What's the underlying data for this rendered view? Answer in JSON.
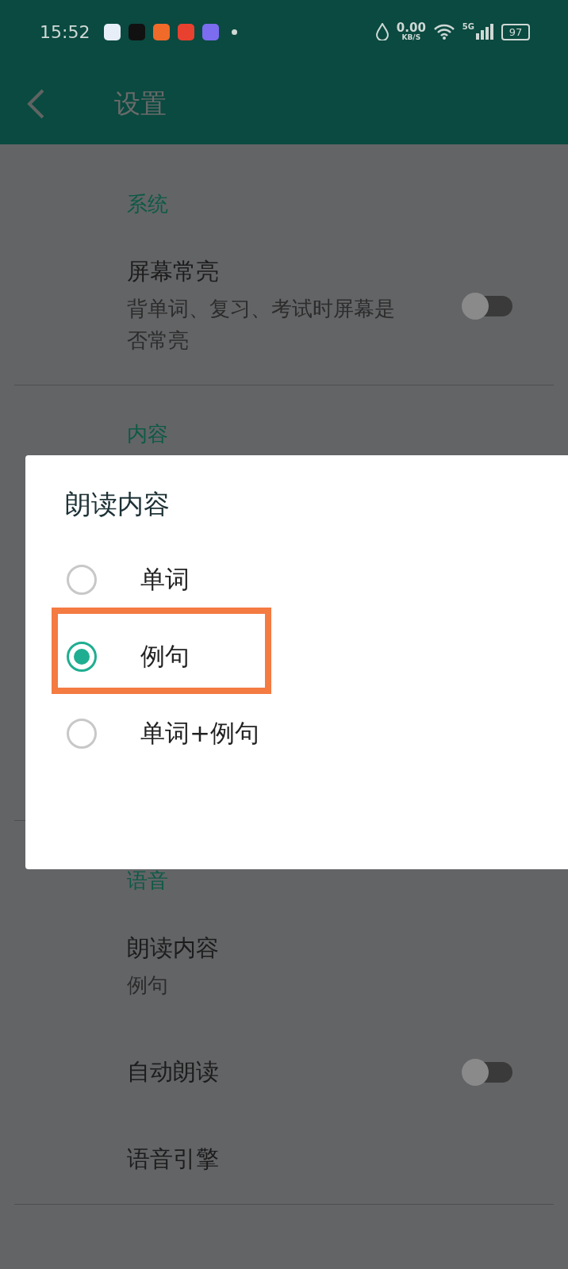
{
  "status_bar": {
    "time": "15:52",
    "net_speed": "0.00",
    "net_unit": "KB/S",
    "network": "5G",
    "battery": "97"
  },
  "app_bar": {
    "title": "设置"
  },
  "sections": [
    {
      "header": "系统",
      "items": [
        {
          "kind": "toggle",
          "title": "屏幕常亮",
          "subtitle": "背单词、复习、考试时屏幕是否常亮",
          "on": false
        }
      ]
    },
    {
      "header": "内容"
    },
    {
      "header": "语音",
      "items": [
        {
          "kind": "text",
          "title": "朗读内容",
          "subtitle": "例句"
        },
        {
          "kind": "toggle",
          "title": "自动朗读",
          "on": false
        },
        {
          "kind": "text",
          "title": "语音引擎"
        }
      ]
    }
  ],
  "dialog": {
    "title": "朗读内容",
    "options": [
      {
        "label": "单词",
        "selected": false,
        "highlighted": false
      },
      {
        "label": "例句",
        "selected": true,
        "highlighted": true
      },
      {
        "label": "单词+例句",
        "selected": false,
        "highlighted": false
      }
    ]
  }
}
